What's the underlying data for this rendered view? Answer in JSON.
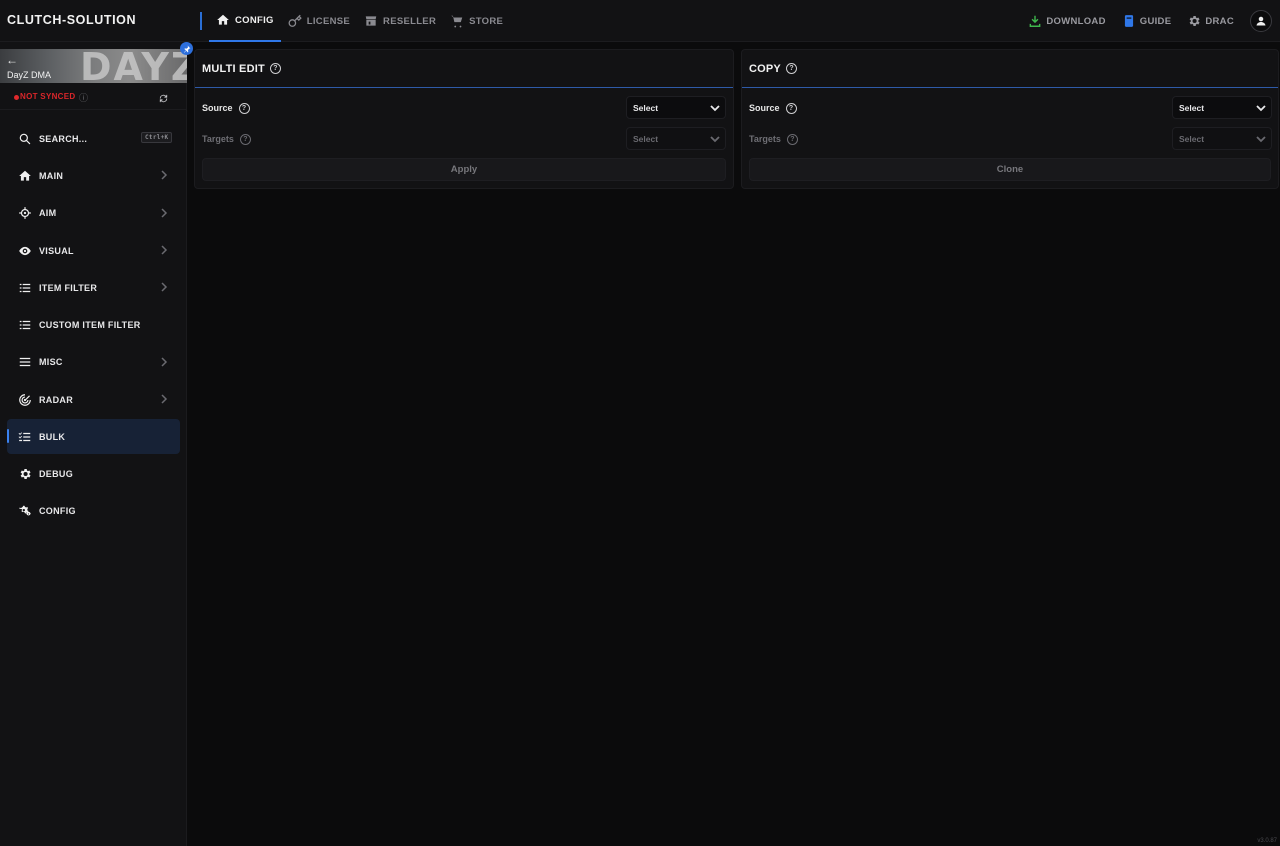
{
  "brand": "CLUTCH-SOLUTION",
  "nav": {
    "tabs": [
      {
        "label": "CONFIG",
        "icon": "home-icon",
        "active": true
      },
      {
        "label": "LICENSE",
        "icon": "key-icon",
        "active": false
      },
      {
        "label": "RESELLER",
        "icon": "store-icon",
        "active": false
      },
      {
        "label": "STORE",
        "icon": "cart-icon",
        "active": false
      }
    ],
    "right": {
      "download": "DOWNLOAD",
      "guide": "GUIDE",
      "user": "DRAC"
    }
  },
  "sidebar": {
    "game_name": "DayZ DMA",
    "banner_text": "DAYZ",
    "sync_status": "NOT SYNCED",
    "search": {
      "label": "SEARCH...",
      "shortcut": "Ctrl+K"
    },
    "items": [
      {
        "label": "MAIN",
        "icon": "home-icon",
        "has_submenu": true
      },
      {
        "label": "AIM",
        "icon": "crosshair-icon",
        "has_submenu": true
      },
      {
        "label": "VISUAL",
        "icon": "eye-icon",
        "has_submenu": true
      },
      {
        "label": "ITEM FILTER",
        "icon": "list-icon",
        "has_submenu": true
      },
      {
        "label": "CUSTOM ITEM FILTER",
        "icon": "list-icon",
        "has_submenu": false
      },
      {
        "label": "MISC",
        "icon": "menu-icon",
        "has_submenu": true
      },
      {
        "label": "RADAR",
        "icon": "radar-icon",
        "has_submenu": true
      },
      {
        "label": "BULK",
        "icon": "checklist-icon",
        "has_submenu": false,
        "active": true
      },
      {
        "label": "DEBUG",
        "icon": "gear-icon",
        "has_submenu": false
      },
      {
        "label": "CONFIG",
        "icon": "gears-icon",
        "has_submenu": false
      }
    ]
  },
  "multi_edit": {
    "title": "MULTI EDIT",
    "source_label": "Source",
    "source_value": "Select",
    "targets_label": "Targets",
    "targets_value": "Select",
    "button": "Apply"
  },
  "copy": {
    "title": "COPY",
    "source_label": "Source",
    "source_value": "Select",
    "targets_label": "Targets",
    "targets_value": "Select",
    "button": "Clone"
  },
  "version": "v3.0.87",
  "colors": {
    "accent": "#2f77e8",
    "danger": "#e0292c",
    "download": "#3fb84d",
    "guide": "#2f77e8",
    "background": "#0b0b0c",
    "panel": "#121214"
  }
}
